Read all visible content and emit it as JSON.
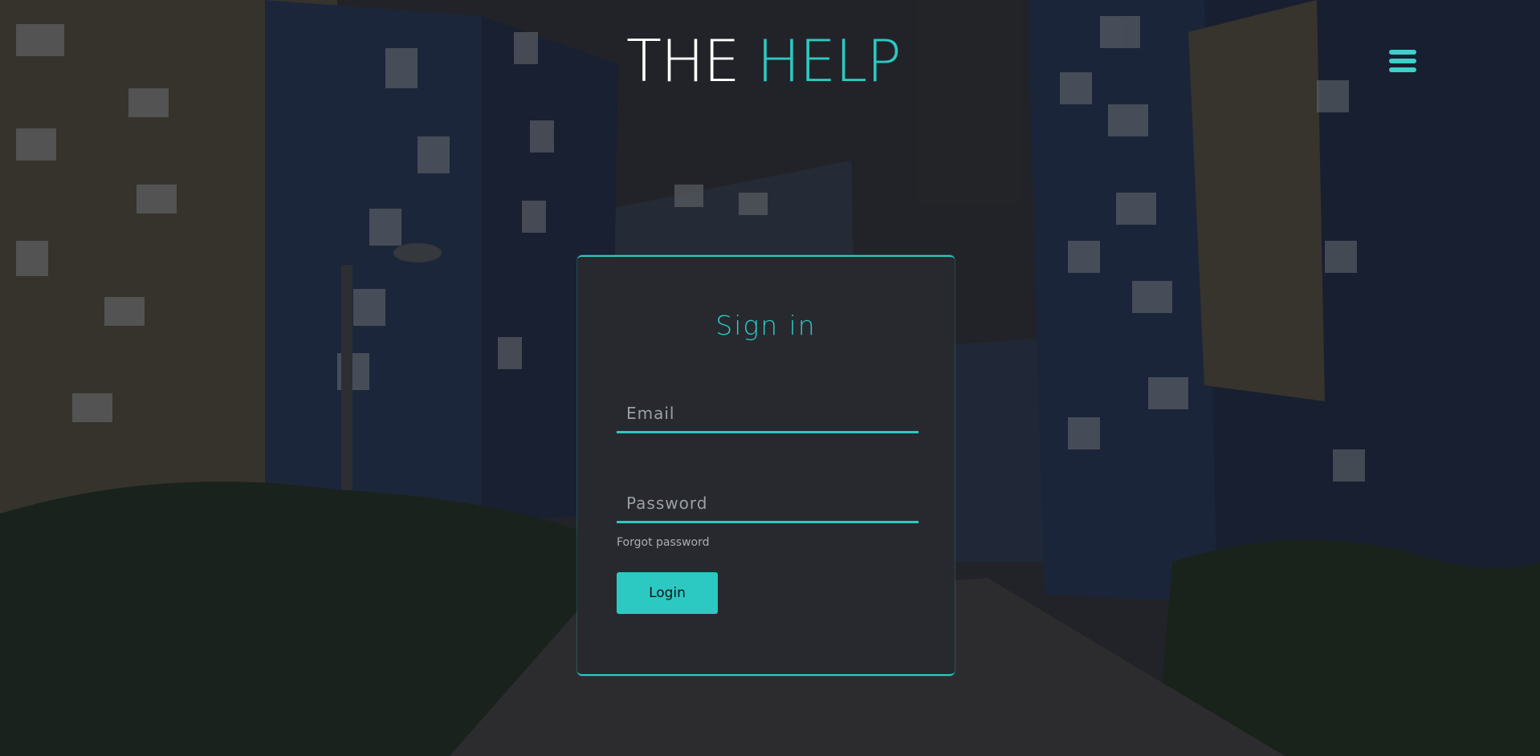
{
  "header": {
    "brand_word1": "THE",
    "brand_word2": "HELP",
    "menu_icon": "hamburger-menu-icon"
  },
  "signin": {
    "title": "Sign in",
    "email_placeholder": "Email",
    "password_placeholder": "Password",
    "forgot_label": "Forgot password",
    "login_label": "Login"
  },
  "colors": {
    "accent": "#2cc9c2",
    "card_bg": "#282a2f",
    "brand_white": "#ffffff"
  }
}
